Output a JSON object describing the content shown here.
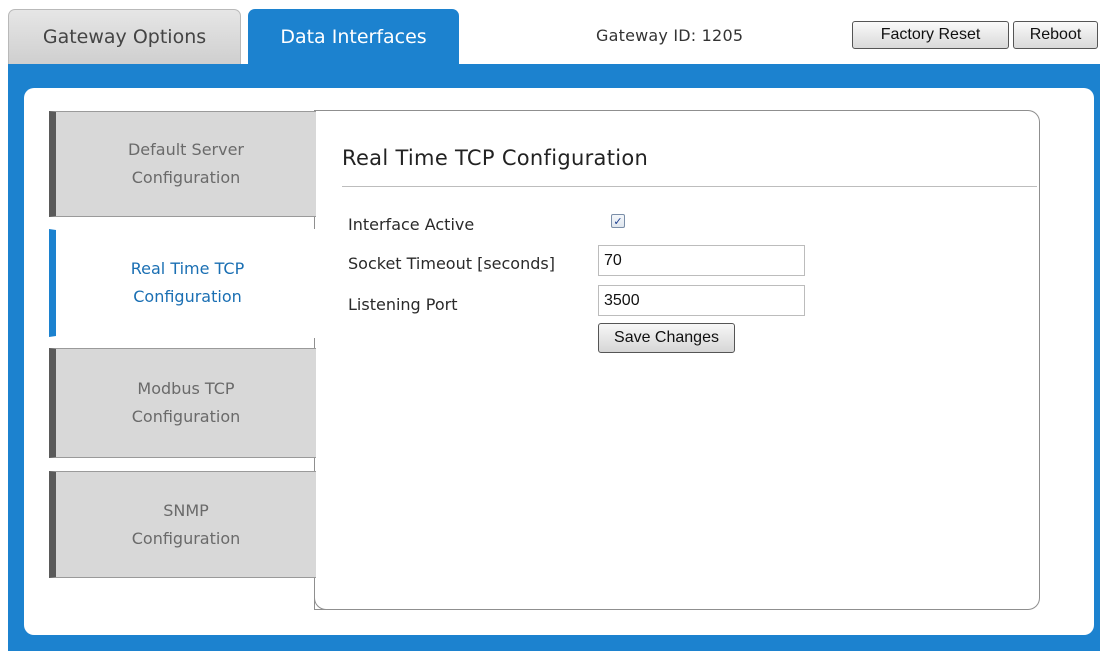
{
  "tabs": {
    "gateway_options": "Gateway Options",
    "data_interfaces": "Data Interfaces"
  },
  "header": {
    "gateway_id": "Gateway ID: 1205",
    "factory_reset_label": "Factory Reset",
    "reboot_label": "Reboot"
  },
  "sidebar": {
    "items": [
      {
        "label": "Default Server\nConfiguration",
        "active": false
      },
      {
        "label": "Real Time TCP\nConfiguration",
        "active": true
      },
      {
        "label": "Modbus TCP\nConfiguration",
        "active": false
      },
      {
        "label": "SNMP\nConfiguration",
        "active": false
      }
    ]
  },
  "panel": {
    "title": "Real Time TCP Configuration",
    "interface_active_label": "Interface Active",
    "interface_active_checked": true,
    "check_glyph": "✓",
    "socket_timeout_label": "Socket Timeout [seconds]",
    "socket_timeout_value": "70",
    "listening_port_label": "Listening Port",
    "listening_port_value": "3500",
    "save_label": "Save Changes"
  },
  "colors": {
    "accent_blue": "#1c82cf",
    "active_nav_text": "#1a6fb3",
    "inactive_nav_bg": "#d8d8d8"
  }
}
